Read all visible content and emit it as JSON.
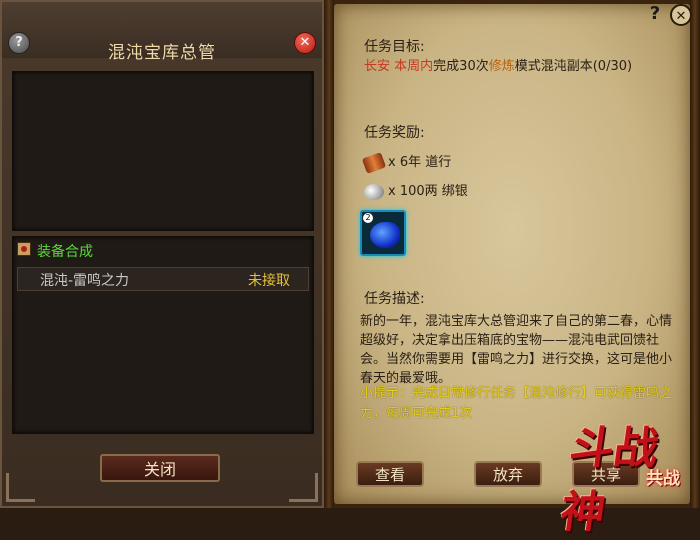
{
  "left_dialog": {
    "title": "混沌宝库总管",
    "help_icon": "?",
    "close_icon": "✕",
    "category": {
      "label": "装备合成"
    },
    "items": [
      {
        "name": "混沌-雷鸣之力",
        "status": "未接取"
      }
    ],
    "close_button": "关闭"
  },
  "quest": {
    "help_icon": "?",
    "close_icon": "✕",
    "target_heading": "任务目标:",
    "target": {
      "location": "长安",
      "period": "本周内",
      "text_1": "完成30次",
      "mode": "修炼",
      "text_2": "模式混沌副本(0/30)"
    },
    "reward_heading": "任务奖励:",
    "rewards": [
      {
        "icon": "daoxing-scroll-icon",
        "text": "x 6年 道行"
      },
      {
        "icon": "silver-ingot-icon",
        "text": "x 100两 绑银"
      }
    ],
    "reward_item": {
      "icon": "blue-orb-item-icon",
      "badge": "2"
    },
    "desc_heading": "任务描述:",
    "description": "新的一年，混沌宝库大总管迎来了自己的第二春，心情超级好，决定拿出压箱底的宝物——混沌电武回馈社会。当然你需要用【雷鸣之力】进行交换，这可是他小春天的最爱哦。",
    "tip": "小提示：完成日常修行任务【混沌修行】可获得雷鸣之力，每周可完成1次",
    "buttons": {
      "view": "查看",
      "abandon": "放弃",
      "share": "共享"
    }
  },
  "logo": {
    "main": "斗战神",
    "sub": "共战"
  },
  "colors": {
    "highlight_red": "#c4381f",
    "highlight_orange": "#b8620f",
    "tip_yellow": "#e4cf18",
    "category_green": "#5ad83a",
    "status_yellow": "#e3c03a"
  }
}
